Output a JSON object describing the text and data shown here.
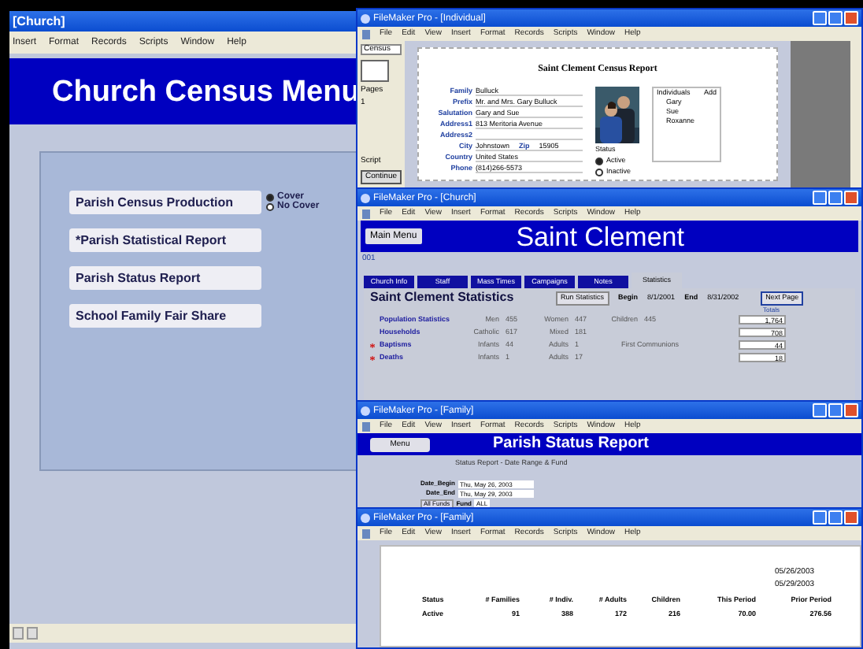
{
  "main_window": {
    "title": "[Church]",
    "menu": [
      "Insert",
      "Format",
      "Records",
      "Scripts",
      "Window",
      "Help"
    ],
    "header": "Church Census Menu",
    "buttons": [
      {
        "label": "Parish Census Production"
      },
      {
        "label": "*Parish Statistical Report"
      },
      {
        "label": "Parish Status Report"
      },
      {
        "label": "School Family Fair Share"
      }
    ],
    "cover_options": [
      {
        "label": "Cover",
        "selected": true
      },
      {
        "label": "No Cover",
        "selected": false
      }
    ]
  },
  "individual_window": {
    "title": "FileMaker Pro - [Individual]",
    "menu": [
      "File",
      "Edit",
      "View",
      "Insert",
      "Format",
      "Records",
      "Scripts",
      "Window",
      "Help"
    ],
    "layout_menu": "Census",
    "pages_label": "Pages",
    "page": "1",
    "script_label": "Script",
    "continue_button": "Continue",
    "report_title": "Saint Clement Census Report",
    "fields": [
      {
        "label": "Family",
        "value": "Bulluck"
      },
      {
        "label": "Prefix",
        "value": "Mr. and Mrs. Gary Bulluck"
      },
      {
        "label": "Salutation",
        "value": "Gary and Sue"
      },
      {
        "label": "Address1",
        "value": "813 Meritoria Avenue"
      },
      {
        "label": "Address2"
      },
      {
        "label": "City",
        "value": "Johnstown"
      },
      {
        "label": "Country",
        "value": "United States"
      },
      {
        "label": "Phone",
        "value": "(814)266-5573"
      }
    ],
    "zip_label": "Zip",
    "zip": "15905",
    "individuals_label": "Individuals",
    "add_label": "Add",
    "individuals": [
      "Gary",
      "Sue",
      "Roxanne"
    ],
    "status_label": "Status",
    "status_options": [
      {
        "label": "Active",
        "selected": true
      },
      {
        "label": "Inactive",
        "selected": false
      }
    ]
  },
  "church_window": {
    "title": "FileMaker Pro - [Church]",
    "menu": [
      "File",
      "Edit",
      "View",
      "Insert",
      "Format",
      "Records",
      "Scripts",
      "Window",
      "Help"
    ],
    "main_menu_button": "Main Menu",
    "header": "Saint Clement",
    "number": "001",
    "tabs": [
      {
        "label": "Church Info",
        "selected": false
      },
      {
        "label": "Staff",
        "selected": false
      },
      {
        "label": "Mass Times",
        "selected": false
      },
      {
        "label": "Campaigns",
        "selected": false
      },
      {
        "label": "Notes",
        "selected": false
      },
      {
        "label": "Statistics",
        "selected": true
      }
    ],
    "stats_title": "Saint Clement  Statistics",
    "run_button": "Run Statistics",
    "begin_label": "Begin",
    "begin": "8/1/2001",
    "end_label": "End",
    "end": "8/31/2002",
    "next_button": "Next Page",
    "totals_label": "Totals",
    "rows": [
      {
        "label": "Population Statistics",
        "marked": false,
        "cells": [
          "Men",
          "455",
          "Women",
          "447",
          "Children",
          "445"
        ],
        "total": "1,764"
      },
      {
        "label": "Households",
        "marked": false,
        "cells": [
          "Catholic",
          "617",
          "Mixed",
          "181"
        ],
        "total": "708"
      },
      {
        "label": "Baptisms",
        "marked": true,
        "cells": [
          "Infants",
          "44",
          "Adults",
          "1",
          "First Communions"
        ],
        "total": "44"
      },
      {
        "label": "Deaths",
        "marked": true,
        "cells": [
          "Infants",
          "1",
          "Adults",
          "17"
        ],
        "total": "18"
      }
    ]
  },
  "status_window": {
    "title": "FileMaker Pro - [Family]",
    "menu": [
      "File",
      "Edit",
      "View",
      "Insert",
      "Format",
      "Records",
      "Scripts",
      "Window",
      "Help"
    ],
    "menu_button": "Menu",
    "header": "Parish Status Report",
    "subtitle": "Status Report - Date Range & Fund",
    "fields": [
      {
        "label": "Date_Begin",
        "value": "Thu, May 26, 2003"
      },
      {
        "label": "Date_End",
        "value": "Thu, May 29, 2003"
      }
    ],
    "all_funds_button": "All Funds",
    "fund_label": "Fund",
    "fund": "ALL"
  },
  "report_window": {
    "title": "FileMaker Pro - [Family]",
    "menu": [
      "File",
      "Edit",
      "View",
      "Insert",
      "Format",
      "Records",
      "Scripts",
      "Window",
      "Help"
    ],
    "dates": [
      "05/26/2003",
      "05/29/2003"
    ],
    "columns": [
      "Status",
      "# Families",
      "# Indiv.",
      "# Adults",
      "Children",
      "This Period",
      "Prior Period"
    ],
    "rows": [
      [
        "Active",
        "91",
        "388",
        "172",
        "216",
        "70.00",
        "276.56"
      ]
    ]
  }
}
